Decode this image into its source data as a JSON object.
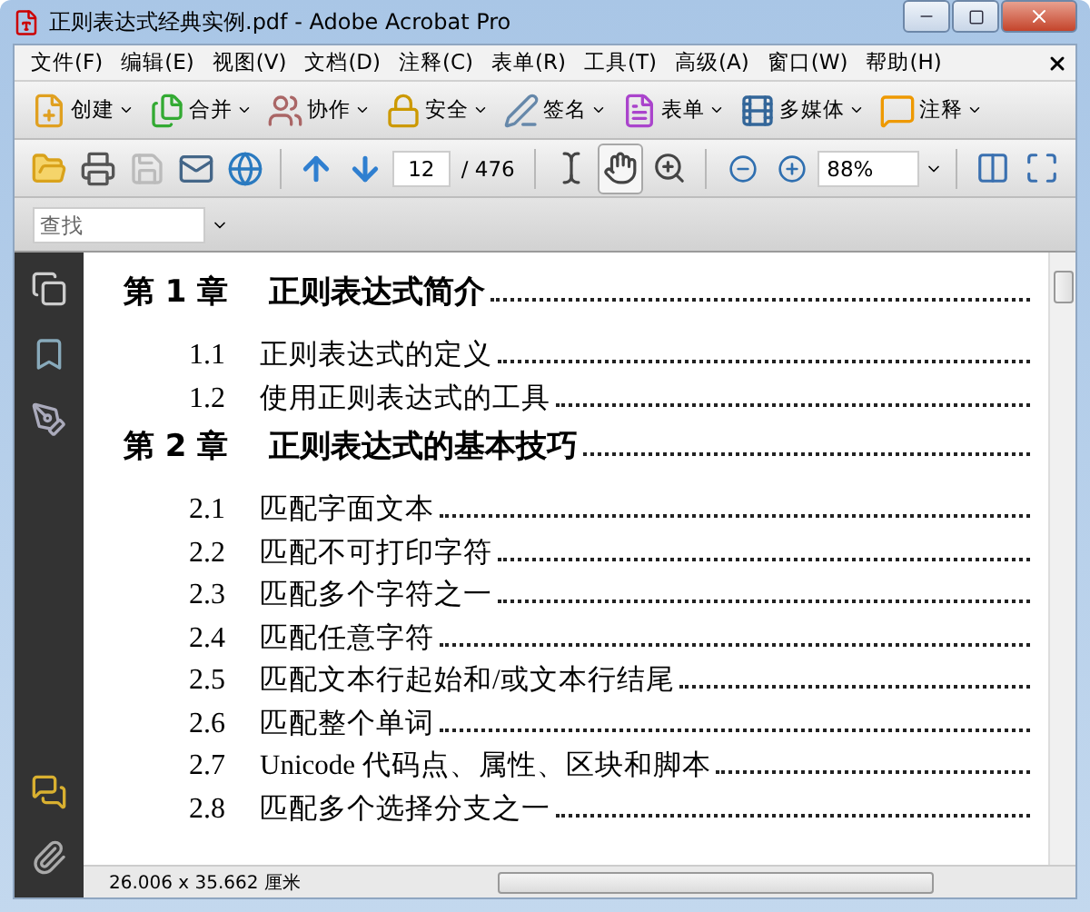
{
  "window": {
    "title": "正则表达式经典实例.pdf - Adobe Acrobat Pro"
  },
  "menu": [
    "文件(F)",
    "编辑(E)",
    "视图(V)",
    "文档(D)",
    "注释(C)",
    "表单(R)",
    "工具(T)",
    "高级(A)",
    "窗口(W)",
    "帮助(H)"
  ],
  "task_buttons": [
    "创建",
    "合并",
    "协作",
    "安全",
    "签名",
    "表单",
    "多媒体",
    "注释"
  ],
  "toolbar": {
    "page_number": "12",
    "page_total": "/ 476",
    "zoom": "88%",
    "tools": [
      {
        "selected": false
      },
      {
        "selected": true
      },
      {
        "selected": false
      }
    ]
  },
  "find": {
    "placeholder": "查找"
  },
  "toc": [
    {
      "kind": "chapter",
      "number": "第 1 章",
      "title": "正则表达式简介"
    },
    {
      "kind": "section",
      "number": "1.1",
      "title": "正则表达式的定义"
    },
    {
      "kind": "section",
      "number": "1.2",
      "title": "使用正则表达式的工具"
    },
    {
      "kind": "chapter",
      "number": "第 2 章",
      "title": "正则表达式的基本技巧"
    },
    {
      "kind": "section",
      "number": "2.1",
      "title": "匹配字面文本"
    },
    {
      "kind": "section",
      "number": "2.2",
      "title": "匹配不可打印字符"
    },
    {
      "kind": "section",
      "number": "2.3",
      "title": "匹配多个字符之一"
    },
    {
      "kind": "section",
      "number": "2.4",
      "title": "匹配任意字符"
    },
    {
      "kind": "section",
      "number": "2.5",
      "title": "匹配文本行起始和/或文本行结尾"
    },
    {
      "kind": "section",
      "number": "2.6",
      "title": "匹配整个单词"
    },
    {
      "kind": "section",
      "number": "2.7",
      "title": "Unicode 代码点、属性、区块和脚本"
    },
    {
      "kind": "section",
      "number": "2.8",
      "title": "匹配多个选择分支之一"
    }
  ],
  "status_bar": {
    "page_size": "26.006 x 35.662 厘米"
  }
}
